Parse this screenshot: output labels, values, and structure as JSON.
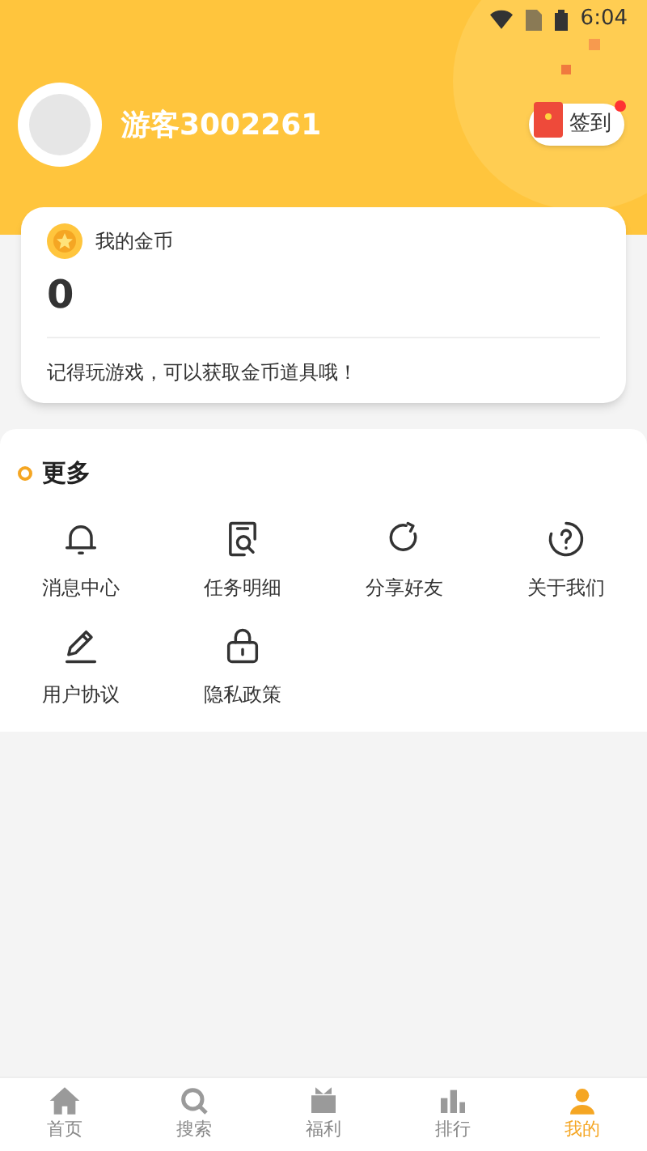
{
  "status_bar": {
    "time": "6:04"
  },
  "profile": {
    "username": "游客3002261",
    "checkin": {
      "label": "签到",
      "has_notification": true
    }
  },
  "coins": {
    "title": "我的金币",
    "amount": "0",
    "hint": "记得玩游戏，可以获取金币道具哦！"
  },
  "more": {
    "title": "更多",
    "items": [
      {
        "label": "消息中心",
        "kind": "bell"
      },
      {
        "label": "任务明细",
        "kind": "doc-search"
      },
      {
        "label": "分享好友",
        "kind": "share"
      },
      {
        "label": "关于我们",
        "kind": "question"
      },
      {
        "label": "用户协议",
        "kind": "pencil"
      },
      {
        "label": "隐私政策",
        "kind": "lock"
      }
    ]
  },
  "tab_bar": [
    {
      "label": "首页",
      "kind": "home",
      "selected": false
    },
    {
      "label": "搜索",
      "kind": "search",
      "selected": false
    },
    {
      "label": "福利",
      "kind": "gift",
      "selected": false
    },
    {
      "label": "排行",
      "kind": "rank",
      "selected": false
    },
    {
      "label": "我的",
      "kind": "user",
      "selected": true
    }
  ]
}
